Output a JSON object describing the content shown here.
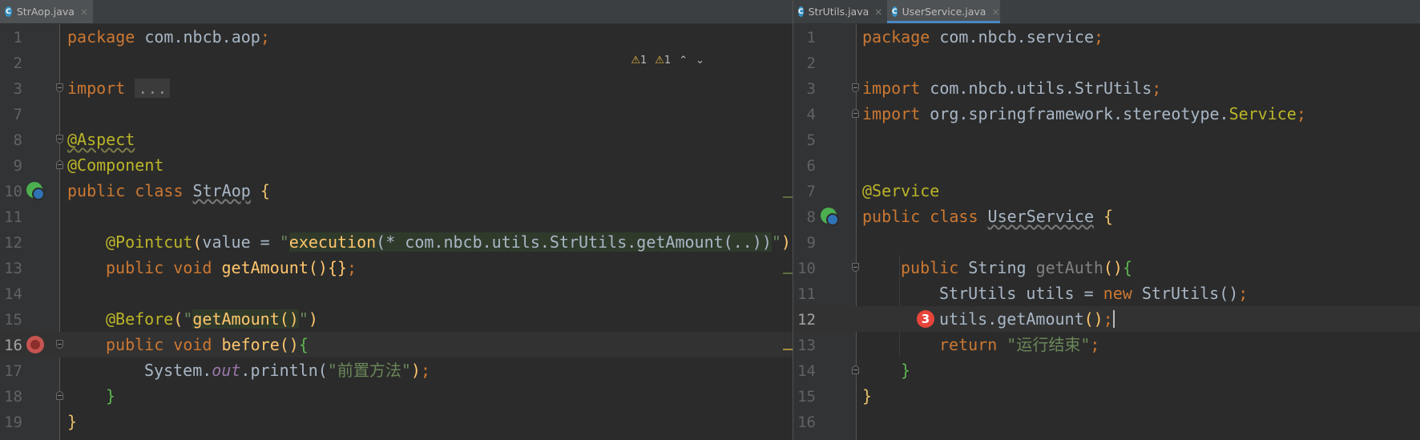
{
  "left_editor": {
    "tab": {
      "filename": "StrAop.java",
      "icon": "java-class-icon"
    },
    "inspections": {
      "warnings_a": "1",
      "warnings_b": "1"
    },
    "lines": [
      {
        "n": "1"
      },
      {
        "n": "2"
      },
      {
        "n": "3"
      },
      {
        "n": "7"
      },
      {
        "n": "8"
      },
      {
        "n": "9"
      },
      {
        "n": "10"
      },
      {
        "n": "11"
      },
      {
        "n": "12"
      },
      {
        "n": "13"
      },
      {
        "n": "14"
      },
      {
        "n": "15"
      },
      {
        "n": "16"
      },
      {
        "n": "17"
      },
      {
        "n": "18"
      },
      {
        "n": "19"
      }
    ],
    "code": {
      "l1_kw": "package",
      "l1_rest": " com.nbcb.aop",
      "l1_semi": ";",
      "l3_kw": "import",
      "l3_fold": "...",
      "l8_ann": "@Aspect",
      "l9_ann": "@Component",
      "l10_kw": "public class",
      "l10_cls": "StrAop",
      "l10_brace": "{",
      "l12_ann": "@Pointcut",
      "l12_open": "(",
      "l12_param": "value = ",
      "l12_q1": "\"",
      "l12_exec": "execution",
      "l12_expr": "(* com.nbcb.utils.StrUtils.getAmount(..))",
      "l12_q2": "\"",
      "l12_close": ")",
      "l13_kw": "public void",
      "l13_fn": "getAmount",
      "l13_rest": "(){}",
      "l13_semi": ";",
      "l15_ann": "@Before",
      "l15_open": "(",
      "l15_q1": "\"",
      "l15_ref": "getAmount()",
      "l15_q2": "\"",
      "l15_close": ")",
      "l16_kw": "public void",
      "l16_fn": "before",
      "l16_rest": "()",
      "l16_brace": "{",
      "l17_sys": "System.",
      "l17_out": "out",
      "l17_call": ".println(",
      "l17_str": "\"前置方法\"",
      "l17_end": ")",
      "l17_semi": ";",
      "l18_brace": "}",
      "l19_brace": "}"
    }
  },
  "right_editor": {
    "tabs": [
      {
        "filename": "StrUtils.java",
        "icon": "java-class-icon"
      },
      {
        "filename": "UserService.java",
        "icon": "java-class-icon"
      }
    ],
    "lines": [
      {
        "n": "1"
      },
      {
        "n": "2"
      },
      {
        "n": "3"
      },
      {
        "n": "4"
      },
      {
        "n": "5"
      },
      {
        "n": "6"
      },
      {
        "n": "7"
      },
      {
        "n": "8"
      },
      {
        "n": "9"
      },
      {
        "n": "10"
      },
      {
        "n": "11"
      },
      {
        "n": "12"
      },
      {
        "n": "13"
      },
      {
        "n": "14"
      },
      {
        "n": "15"
      },
      {
        "n": "16"
      }
    ],
    "code": {
      "l1_kw": "package",
      "l1_rest": " com.nbcb.service",
      "l1_semi": ";",
      "l3_kw": "import",
      "l3_rest": " com.nbcb.utils.StrUtils",
      "l3_semi": ";",
      "l4_kw": "import",
      "l4_rest": " org.springframework.stereotype.",
      "l4_ann": "Service",
      "l4_semi": ";",
      "l7_ann": "@Service",
      "l8_kw": "public class",
      "l8_cls": "UserService",
      "l8_brace": "{",
      "l10_kw": "public",
      "l10_type": " String ",
      "l10_fn": "getAuth",
      "l10_rest": "()",
      "l10_brace": "{",
      "l11_type": "StrUtils utils = ",
      "l11_kw": "new",
      "l11_rest": " StrUtils()",
      "l11_semi": ";",
      "l12_call": "utils.getAmount",
      "l12_paren": "()",
      "l12_semi": ";",
      "l13_kw": "return",
      "l13_str": "\"运行结束\"",
      "l13_semi": ";",
      "l14_brace": "}",
      "l15_brace": "}"
    },
    "step_badge": "3"
  },
  "colors": {
    "background": "#2b2b2b",
    "keyword": "#cc7832",
    "annotation": "#bbb529",
    "string": "#6a8759",
    "method": "#ffc66d",
    "default_text": "#a9b7c6",
    "line_number": "#606366",
    "breakpoint": "#c75450",
    "badge": "#e8453c"
  }
}
